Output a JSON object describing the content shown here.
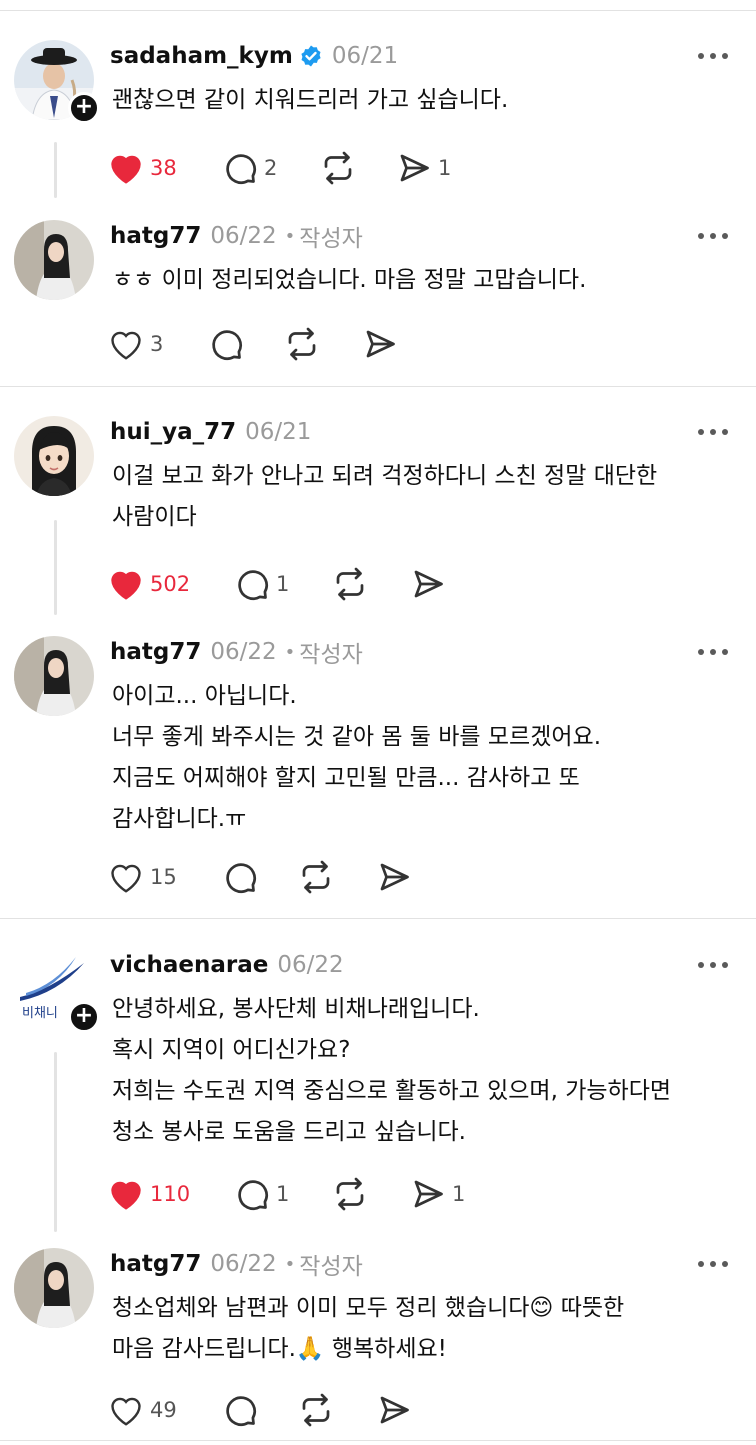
{
  "posts": [
    {
      "username": "sadaham_kym",
      "verified": true,
      "date": "06/21",
      "author_tag": "",
      "lines": [
        "괜찮으면 같이 치워드리러 가고 싶습니다."
      ],
      "likes": "38",
      "liked": true,
      "comments": "2",
      "reposts": "",
      "shares": "1"
    },
    {
      "username": "hatg77",
      "verified": false,
      "date": "06/22",
      "author_tag": "작성자",
      "lines": [
        "ㅎㅎ 이미 정리되었습니다. 마음 정말 고맙습니다."
      ],
      "likes": "3",
      "liked": false,
      "comments": "",
      "reposts": "",
      "shares": ""
    },
    {
      "username": "hui_ya_77",
      "verified": false,
      "date": "06/21",
      "author_tag": "",
      "lines": [
        "이걸 보고 화가 안나고 되려 걱정하다니 스친 정말 대단한",
        "사람이다"
      ],
      "likes": "502",
      "liked": true,
      "comments": "1",
      "reposts": "",
      "shares": ""
    },
    {
      "username": "hatg77",
      "verified": false,
      "date": "06/22",
      "author_tag": "작성자",
      "lines": [
        "아이고... 아닙니다.",
        "너무 좋게 봐주시는 것 같아 몸 둘 바를 모르겠어요.",
        "지금도 어찌해야 할지 고민될 만큼... 감사하고 또",
        "감사합니다.ㅠ"
      ],
      "likes": "15",
      "liked": false,
      "comments": "",
      "reposts": "",
      "shares": ""
    },
    {
      "username": "vichaenarae",
      "verified": false,
      "date": "06/22",
      "author_tag": "",
      "lines": [
        "안녕하세요, 봉사단체 비채나래입니다.",
        "혹시 지역이 어디신가요?",
        "저희는 수도권 지역 중심으로 활동하고 있으며, 가능하다면",
        "청소 봉사로 도움을 드리고 싶습니다."
      ],
      "logo_text": "비채니",
      "likes": "110",
      "liked": true,
      "comments": "1",
      "reposts": "",
      "shares": "1"
    },
    {
      "username": "hatg77",
      "verified": false,
      "date": "06/22",
      "author_tag": "작성자",
      "lines": [
        "청소업체와 남편과 이미 모두 정리 했습니다😊 따뜻한",
        "마음 감사드립니다.🙏 행복하세요!"
      ],
      "likes": "49",
      "liked": false,
      "comments": "",
      "reposts": "",
      "shares": ""
    }
  ],
  "colors": {
    "like_active": "#e8283c",
    "verified": "#1d9bf0",
    "muted": "#9a9a9a"
  },
  "icons": [
    "heart-icon",
    "comment-icon",
    "repost-icon",
    "share-icon",
    "more-icon",
    "verified-icon",
    "follow-plus-icon"
  ]
}
